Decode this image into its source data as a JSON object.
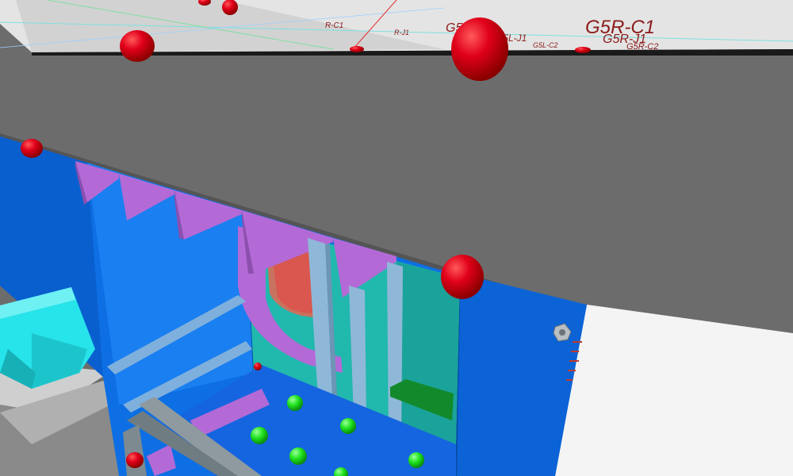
{
  "viewport": {
    "labels": {
      "g5r_c1": "G5R-C1",
      "g5r_j1": "G5R-J1",
      "g5r_c2": "G5R-C2",
      "g5l_j1_top": "G5L-J1",
      "g5l_j1": "G5L-J1",
      "g5l_c2": "G5L-C2",
      "r_c1": "R-C1",
      "r_j1": "R-J1"
    }
  },
  "colors": {
    "background_gray": "#6c6c6c",
    "floor_light": "#e6e6e6",
    "steel_blue": "#0d6fe3",
    "cyan_part": "#27e3ea",
    "teal_part": "#21b8ae",
    "purple_part": "#b36ad6",
    "bolt_green": "#1fe51f",
    "flat_bar_green": "#128a2c",
    "marker_red": "#e0001a",
    "label_red": "#8b1a1a"
  }
}
